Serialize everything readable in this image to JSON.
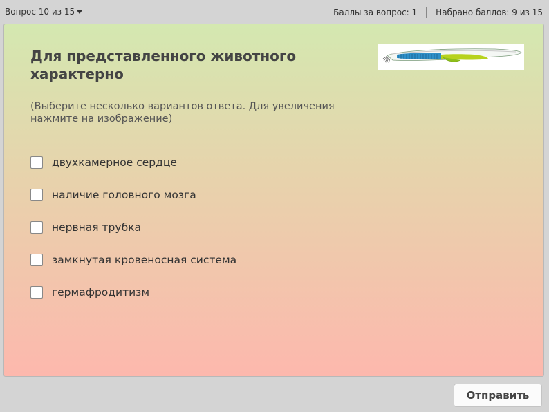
{
  "header": {
    "question_nav": "Вопрос 10 из 15",
    "points_per_question": "Баллы за вопрос: 1",
    "points_total": "Набрано баллов: 9 из 15"
  },
  "question": {
    "title": "Для представленного животного характерно",
    "hint": "(Выберите несколько вариантов ответа. Для увеличения нажмите на изображение)",
    "image_icon": "lancelet-image",
    "options": [
      {
        "label": "двухкамерное сердце",
        "checked": false
      },
      {
        "label": "наличие головного мозга",
        "checked": false
      },
      {
        "label": "нервная трубка",
        "checked": false
      },
      {
        "label": "замкнутая кровеносная система",
        "checked": false
      },
      {
        "label": "гермафродитизм",
        "checked": false
      }
    ]
  },
  "footer": {
    "submit_label": "Отправить"
  },
  "colors": {
    "gradient_top": "#d4e8b0",
    "gradient_bottom": "#fdb8ad",
    "background": "#d4d4d4"
  }
}
